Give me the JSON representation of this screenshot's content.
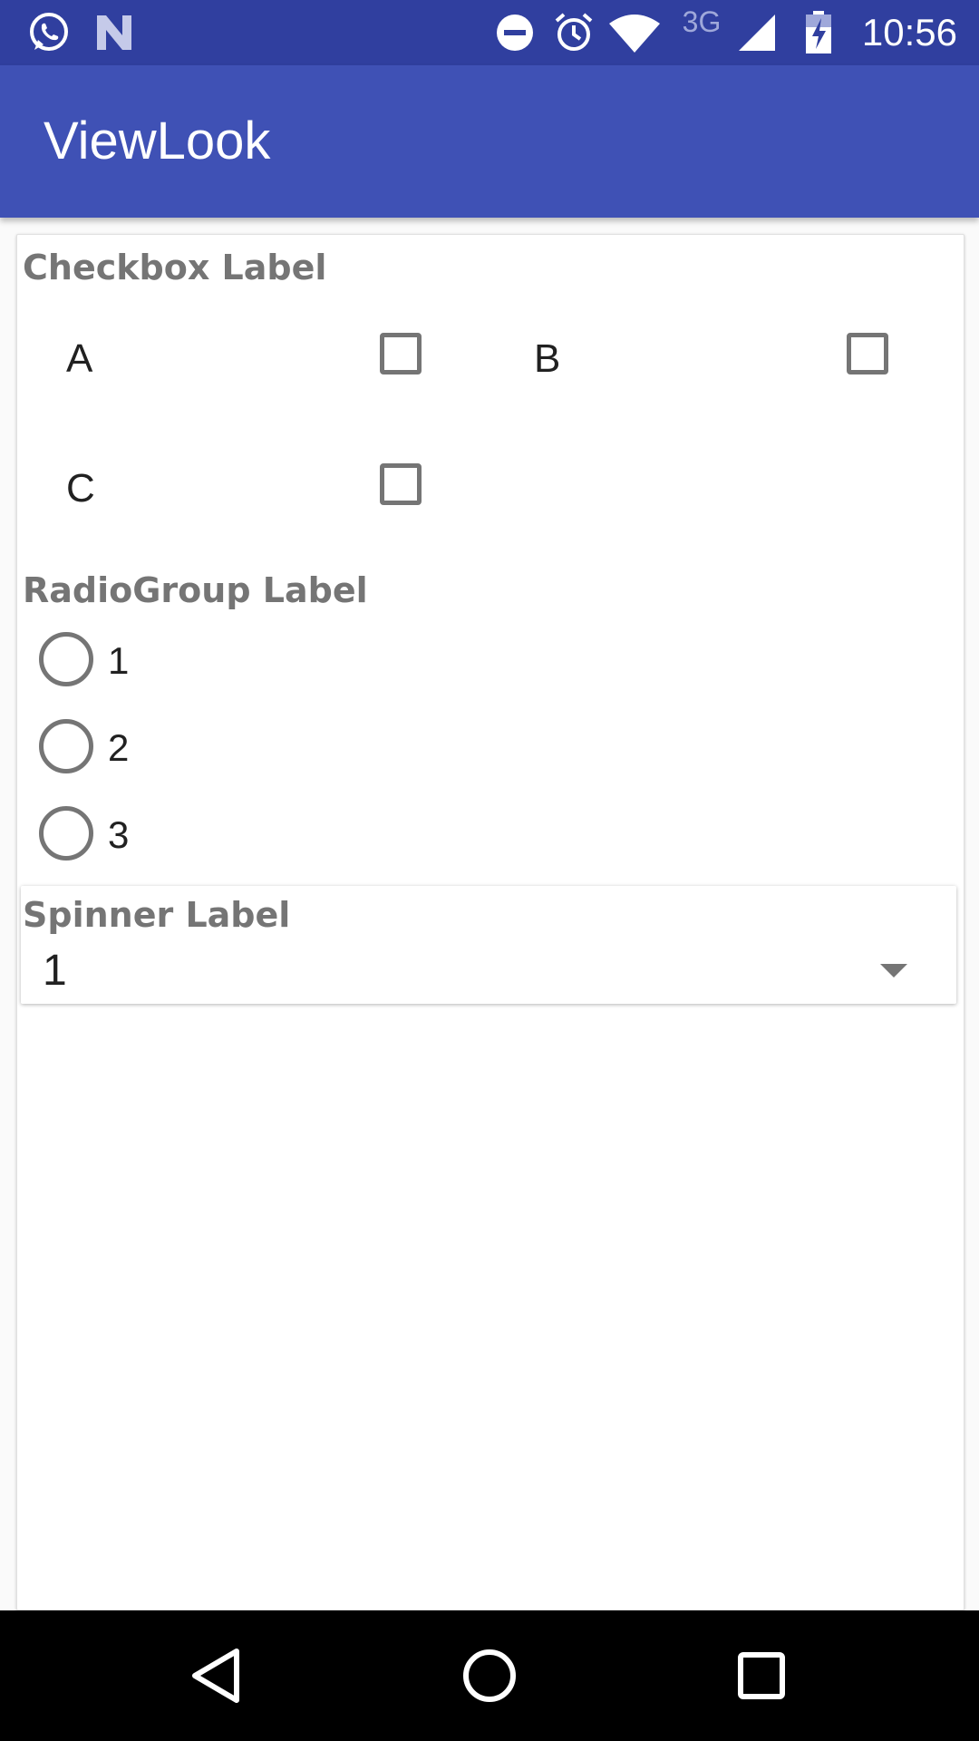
{
  "status_bar": {
    "time": "10:56",
    "network": "3G",
    "icons": [
      "whatsapp-icon",
      "n-icon",
      "do-not-disturb-icon",
      "alarm-icon",
      "wifi-icon",
      "signal-icon",
      "battery-charging-icon"
    ]
  },
  "app_bar": {
    "title": "ViewLook"
  },
  "checkbox_section": {
    "label": "Checkbox Label",
    "options": [
      {
        "label": "A",
        "checked": false
      },
      {
        "label": "B",
        "checked": false
      },
      {
        "label": "C",
        "checked": false
      }
    ]
  },
  "radio_section": {
    "label": "RadioGroup Label",
    "options": [
      {
        "label": "1",
        "selected": false
      },
      {
        "label": "2",
        "selected": false
      },
      {
        "label": "3",
        "selected": false
      }
    ]
  },
  "spinner_section": {
    "label": "Spinner Label",
    "selected_value": "1"
  },
  "colors": {
    "status_bar": "#303F9F",
    "app_bar": "#3F51B5",
    "label_gray": "#757575"
  }
}
